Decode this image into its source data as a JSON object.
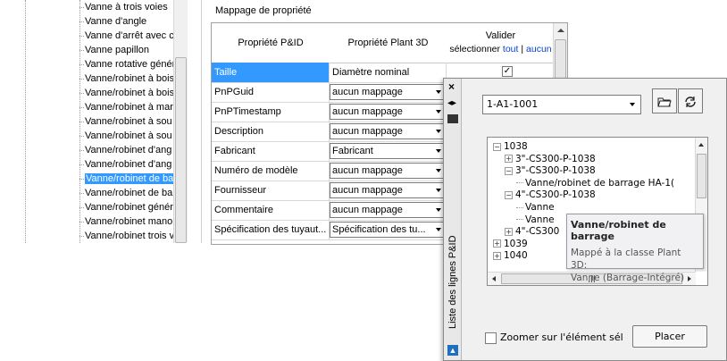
{
  "left_tree": {
    "items": [
      "Vanne à trois voies",
      "Vanne d'angle",
      "Vanne d'arrêt avec c",
      "Vanne papillon",
      "Vanne rotative génér",
      "Vanne/robinet à bois",
      "Vanne/robinet à bois",
      "Vanne/robinet à mar",
      "Vanne/robinet à sou",
      "Vanne/robinet à sou",
      "Vanne/robinet d'ang",
      "Vanne/robinet d'ang",
      "Vanne/robinet de ba",
      "Vanne/robinet de ba",
      "Vanne/robinet génér",
      "Vanne/robinet mano",
      "Vanne/robinet trois v"
    ],
    "selected_index": 12
  },
  "mapping": {
    "title": "Mappage de propriété",
    "headers": {
      "pid": "Propriété P&ID",
      "plant": "Propriété Plant 3D",
      "validate": "Valider",
      "select": "sélectionner",
      "all": "tout",
      "sep": "|",
      "none": "aucun"
    },
    "rows": [
      {
        "pid": "Taille",
        "plant": "Diamètre nominal",
        "checked": true,
        "selected": true,
        "combo": false
      },
      {
        "pid": "PnPGuid",
        "plant": "aucun mappage",
        "combo": true
      },
      {
        "pid": "PnPTimestamp",
        "plant": "aucun mappage",
        "combo": true
      },
      {
        "pid": "Description",
        "plant": "aucun mappage",
        "combo": true
      },
      {
        "pid": "Fabricant",
        "plant": "Fabricant",
        "combo": true
      },
      {
        "pid": "Numéro de modèle",
        "plant": "aucun mappage",
        "combo": true
      },
      {
        "pid": "Fournisseur",
        "plant": "aucun mappage",
        "combo": true
      },
      {
        "pid": "Commentaire",
        "plant": "aucun mappage",
        "combo": true
      },
      {
        "pid": "Spécification des tuyaut...",
        "plant": "Spécification des tu...",
        "combo": true
      }
    ]
  },
  "palette": {
    "title": "Liste des lignes P&ID",
    "close": "×",
    "line_select": "1-A1-1001",
    "tree": [
      {
        "text": "1038",
        "expander": "⊟",
        "level": 0
      },
      {
        "text": "3\"-CS300-P-1038",
        "expander": "⊞",
        "level": 1
      },
      {
        "text": "3\"-CS300-P-1038",
        "expander": "⊟",
        "level": 1
      },
      {
        "text": "Vanne/robinet de barrage HA-1(",
        "expander": "",
        "level": 2
      },
      {
        "text": "4\"-CS300-P-1038",
        "expander": "⊟",
        "level": 1
      },
      {
        "text": "Vanne",
        "expander": "",
        "level": 2
      },
      {
        "text": "Vanne",
        "expander": "",
        "level": 2
      },
      {
        "text": "4\"-CS300",
        "expander": "⊞",
        "level": 1
      },
      {
        "text": "1039",
        "expander": "⊞",
        "level": 0
      },
      {
        "text": "1040",
        "expander": "⊞",
        "level": 0
      }
    ],
    "tooltip": {
      "title": "Vanne/robinet de barrage",
      "line1": "Mappé à la classe Plant 3D:",
      "line2": "Vanne (Barrage-Intégré)"
    },
    "zoom_label": "Zoomer sur l'élément sél",
    "placer": "Placer"
  }
}
